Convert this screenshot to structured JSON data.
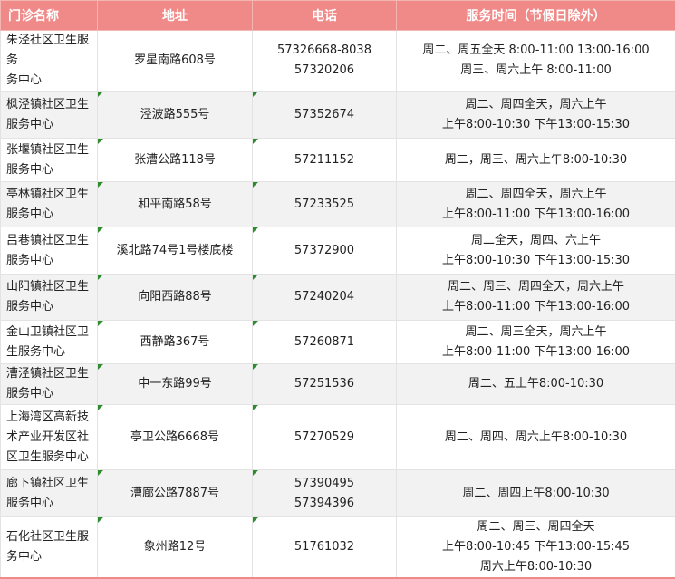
{
  "table": {
    "headers": {
      "name": "门诊名称",
      "address": "地址",
      "phone": "电话",
      "hours": "服务时间（节假日除外）"
    },
    "rows": [
      {
        "name": [
          "朱泾社区卫生服务",
          "务中心"
        ],
        "address": [
          "罗星南路608号"
        ],
        "phone": [
          "57326668-8038",
          "57320206"
        ],
        "hours": [
          "周二、周五全天 8:00-11:00 13:00-16:00",
          "周三、周六上午 8:00-11:00"
        ]
      },
      {
        "name": [
          "枫泾镇社区卫生",
          "服务中心"
        ],
        "address": [
          "泾波路555号"
        ],
        "phone": [
          "57352674"
        ],
        "hours": [
          "周二、周四全天，周六上午",
          "上午8:00-10:30 下午13:00-15:30"
        ]
      },
      {
        "name": [
          "张堰镇社区卫生",
          "服务中心"
        ],
        "address": [
          "张漕公路118号"
        ],
        "phone": [
          "57211152"
        ],
        "hours": [
          "周二，周三、周六上午8:00-10:30"
        ]
      },
      {
        "name": [
          "亭林镇社区卫生",
          "服务中心"
        ],
        "address": [
          "和平南路58号"
        ],
        "phone": [
          "57233525"
        ],
        "hours": [
          "周二、周四全天，周六上午",
          "上午8:00-11:00  下午13:00-16:00"
        ]
      },
      {
        "name": [
          "吕巷镇社区卫生",
          "服务中心"
        ],
        "address": [
          "溪北路74号1号楼底楼"
        ],
        "phone": [
          "57372900"
        ],
        "hours": [
          "周二全天，周四、六上午",
          "上午8:00-10:30 下午13:00-15:30"
        ]
      },
      {
        "name": [
          "山阳镇社区卫生",
          "服务中心"
        ],
        "address": [
          "向阳西路88号"
        ],
        "phone": [
          "57240204"
        ],
        "hours": [
          "周二、周三、周四全天，周六上午",
          "上午8:00-11:00 下午13:00-16:00"
        ]
      },
      {
        "name": [
          "金山卫镇社区卫",
          "生服务中心"
        ],
        "address": [
          "西静路367号"
        ],
        "phone": [
          "57260871"
        ],
        "hours": [
          "周二、周三全天，周六上午",
          "上午8:00-11:00 下午13:00-16:00"
        ]
      },
      {
        "name": [
          "漕泾镇社区卫生",
          "服务中心"
        ],
        "address": [
          "中一东路99号"
        ],
        "phone": [
          "57251536"
        ],
        "hours": [
          "周二、五上午8:00-10:30"
        ]
      },
      {
        "name": [
          "上海湾区高新技",
          "术产业开发区社",
          "区卫生服务中心"
        ],
        "address": [
          "亭卫公路6668号"
        ],
        "phone": [
          "57270529"
        ],
        "hours": [
          "周二、周四、周六上午8:00-10:30"
        ]
      },
      {
        "name": [
          "廊下镇社区卫生",
          "服务中心"
        ],
        "address": [
          "漕廊公路7887号"
        ],
        "phone": [
          "57390495",
          "57394396"
        ],
        "hours": [
          "周二、周四上午8:00-10:30"
        ]
      },
      {
        "name": [
          "石化社区卫生服",
          "务中心"
        ],
        "address": [
          "象州路12号"
        ],
        "phone": [
          "51761032"
        ],
        "hours": [
          "周二、周三、周四全天",
          "上午8:00-10:45 下午13:00-15:45",
          "周六上午8:00-10:30"
        ]
      }
    ]
  }
}
